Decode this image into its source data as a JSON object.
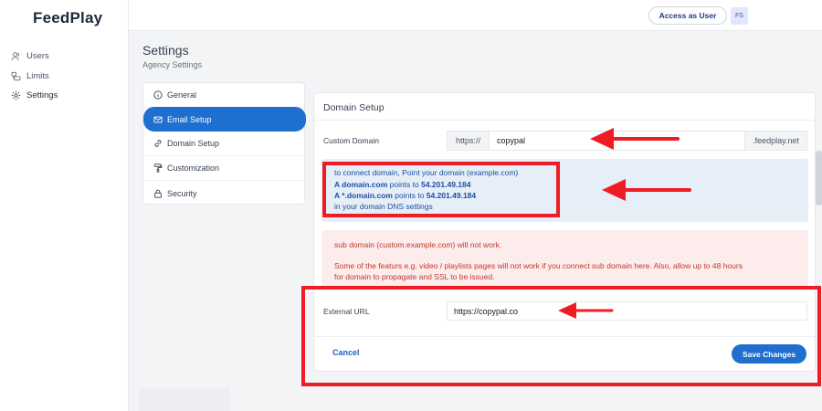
{
  "app": {
    "logo": "FeedPlay",
    "access_label": "Access as User",
    "avatar_initials": "FS"
  },
  "sidebar": {
    "items": [
      {
        "label": "Users",
        "icon": "users-icon"
      },
      {
        "label": "Limits",
        "icon": "limits-icon"
      },
      {
        "label": "Settings",
        "icon": "gear-icon"
      }
    ]
  },
  "header": {
    "title": "Settings",
    "subtitle": "Agency Settings"
  },
  "settings_menu": {
    "items": [
      {
        "label": "General",
        "icon": "info-icon",
        "active": false
      },
      {
        "label": "Email Setup",
        "icon": "mail-icon",
        "active": true
      },
      {
        "label": "Domain Setup",
        "icon": "link-icon",
        "active": false
      },
      {
        "label": "Customization",
        "icon": "paint-roller-icon",
        "active": false
      },
      {
        "label": "Security",
        "icon": "lock-icon",
        "active": false
      }
    ]
  },
  "domain_setup": {
    "title": "Domain Setup",
    "custom_domain_label": "Custom Domain",
    "prefix": "https://",
    "domain_value": "copypal",
    "suffix": ".feedplay.net",
    "info": {
      "line1": "to connect domain, Point your domain (example.com)",
      "line2_bold": "A domain.com",
      "line2_text": " points to ",
      "line2_ip": "54.201.49.184",
      "line3_bold": "A *.domain.com",
      "line3_text": " points to ",
      "line3_ip": "54.201.49.184",
      "line4": "in your domain DNS settings"
    },
    "warning": {
      "line1": "sub domain (custom.example.com) will not work.",
      "line2": "Some of the featurs e.g. video / playlists pages will not work if you connect sub domain here. Also, allow up to 48 hours",
      "line3": "for domain to propagate and SSL to be issued."
    },
    "external_url_label": "External URL",
    "external_url_value": "https://copypal.co",
    "cancel_label": "Cancel",
    "save_label": "Save Changes"
  },
  "colors": {
    "accent": "#1e6fcf",
    "annotation": "#ee1c25",
    "info_bg": "#e6eef8",
    "warning_bg": "#fdecec"
  }
}
